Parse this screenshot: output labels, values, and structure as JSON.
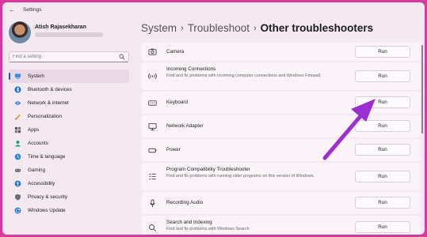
{
  "app": {
    "title": "Settings"
  },
  "profile": {
    "name": "Atish Rajasekharan"
  },
  "search": {
    "placeholder": "Find a setting"
  },
  "sidebar": {
    "items": [
      {
        "label": "System",
        "icon": "system-icon",
        "active": true
      },
      {
        "label": "Bluetooth & devices",
        "icon": "bluetooth-icon"
      },
      {
        "label": "Network & internet",
        "icon": "network-icon"
      },
      {
        "label": "Personalization",
        "icon": "personalization-icon"
      },
      {
        "label": "Apps",
        "icon": "apps-icon"
      },
      {
        "label": "Accounts",
        "icon": "accounts-icon"
      },
      {
        "label": "Time & language",
        "icon": "time-language-icon"
      },
      {
        "label": "Gaming",
        "icon": "gaming-icon"
      },
      {
        "label": "Accessibility",
        "icon": "accessibility-icon"
      },
      {
        "label": "Privacy & security",
        "icon": "privacy-shield-icon"
      },
      {
        "label": "Windows Update",
        "icon": "windows-update-icon"
      }
    ]
  },
  "breadcrumb": {
    "part1": "System",
    "part2": "Troubleshoot",
    "current": "Other troubleshooters",
    "sep": "›"
  },
  "troubleshooters": [
    {
      "title": "Camera",
      "desc": "",
      "icon": "camera-icon",
      "button": "Run"
    },
    {
      "title": "Incoming Connections",
      "desc": "Find and fix problems with incoming computer connections and Windows Firewall.",
      "icon": "wireless-icon",
      "button": "Run"
    },
    {
      "title": "Keyboard",
      "desc": "",
      "icon": "keyboard-icon",
      "button": "Run"
    },
    {
      "title": "Network Adapter",
      "desc": "",
      "icon": "network-adapter-icon",
      "button": "Run"
    },
    {
      "title": "Power",
      "desc": "",
      "icon": "power-icon",
      "button": "Run"
    },
    {
      "title": "Program Compatibility Troubleshooter",
      "desc": "Find and fix problems with running older programs on this version of Windows.",
      "icon": "program-compat-icon",
      "button": "Run"
    },
    {
      "title": "Recording Audio",
      "desc": "",
      "icon": "microphone-icon",
      "button": "Run"
    },
    {
      "title": "Search and Indexing",
      "desc": "Find and fix problems with Windows Search",
      "icon": "search-indexing-icon",
      "button": "Run"
    }
  ],
  "colors": {
    "accent": "#0067c0",
    "annotation_arrow": "#9b2fd1",
    "frame": "#d63a9c"
  }
}
